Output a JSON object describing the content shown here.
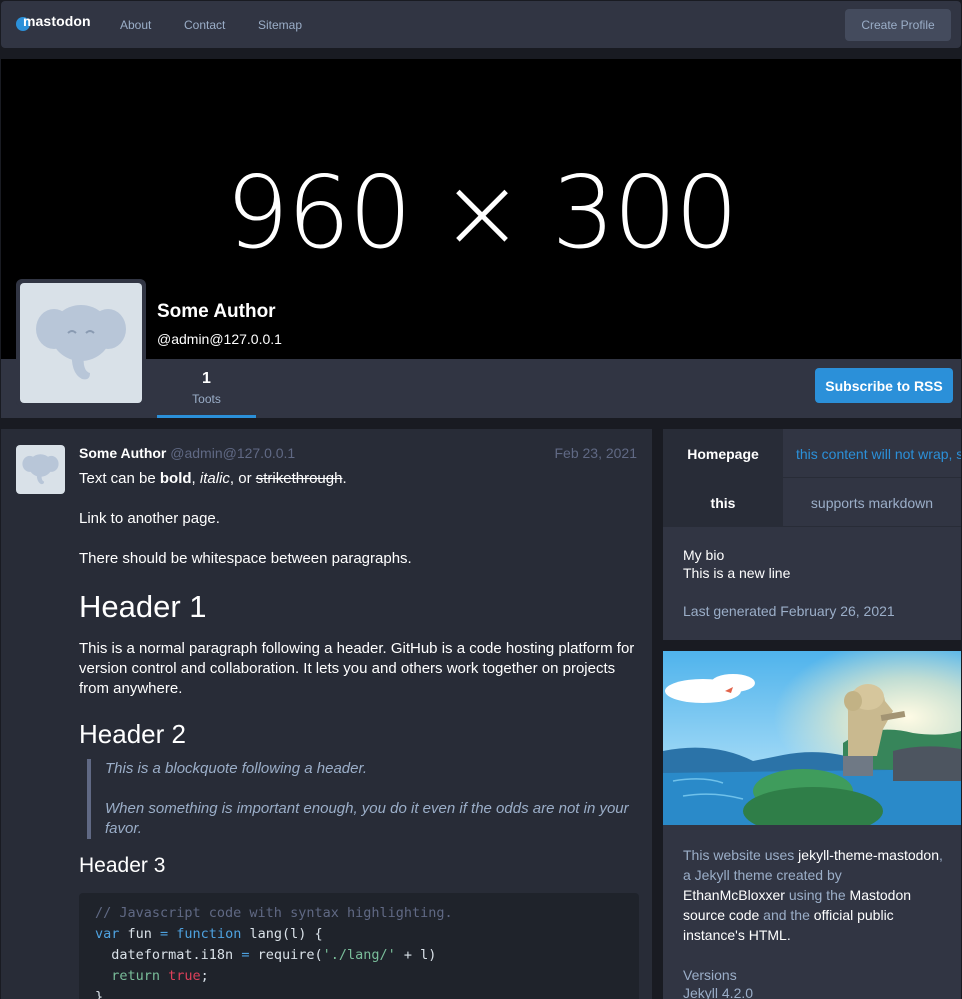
{
  "nav": {
    "logo_text": "mastodon",
    "links": [
      "About",
      "Contact",
      "Sitemap"
    ],
    "create_profile": "Create Profile"
  },
  "profile": {
    "banner_text": "960 × 300",
    "name": "Some Author",
    "handle": "@admin@127.0.0.1",
    "stat_count": "1",
    "stat_label": "Toots",
    "rss_button": "Subscribe to RSS"
  },
  "post": {
    "author": "Some Author",
    "handle": "@admin@127.0.0.1",
    "date": "Feb 23, 2021",
    "line1_pre": "Text can be ",
    "line1_bold": "bold",
    "line1_mid1": ", ",
    "line1_italic": "italic",
    "line1_mid2": ", or ",
    "line1_strike": "strikethrough",
    "line1_end": ".",
    "link_text": "Link to another page.",
    "para2": "There should be whitespace between paragraphs.",
    "h1": "Header 1",
    "para3": "This is a normal paragraph following a header. GitHub is a code hosting platform for version control and collaboration. It lets you and others work together on projects from anywhere.",
    "h2": "Header 2",
    "quote1": "This is a blockquote following a header.",
    "quote2": "When something is important enough, you do it even if the odds are not in your favor.",
    "h3": "Header 3",
    "code_comment": "// Javascript code with syntax highlighting.",
    "code_kw_var": "var",
    "code_var_name": " fun ",
    "code_eq": "=",
    "code_kw_function": " function",
    "code_fn_rest": " lang(l) {",
    "code_line3a": "  dateformat.i18n ",
    "code_line3b": "=",
    "code_line3c": " require(",
    "code_line3d": "'./lang/'",
    "code_line3e": " + l)",
    "code_return": "  return",
    "code_true": " true",
    "code_semi": ";",
    "code_close": "}"
  },
  "sidebar": {
    "tabs": [
      {
        "label": "Homepage"
      },
      {
        "label": "this content will not wrap, s"
      },
      {
        "label": "this"
      },
      {
        "label": "supports markdown"
      }
    ],
    "bio_line1": "My bio",
    "bio_line2": "This is a new line",
    "last_generated": "Last generated February 26, 2021"
  },
  "about": {
    "t1": "This website uses ",
    "t2": "jekyll-theme-mastodon",
    "t3": ", a Jekyll theme created by ",
    "t4": "EthanMcBloxxer",
    "t5": " using the ",
    "t6": "Mastodon source code",
    "t7": " and the ",
    "t8": "official public instance's HTML",
    "t9": ".",
    "versions_label": "Versions",
    "jekyll_version": "Jekyll 4.2.0"
  },
  "colors": {
    "accent": "#2b90d9",
    "background": "#191b22",
    "card": "#313543",
    "post_bg": "#282c37"
  }
}
